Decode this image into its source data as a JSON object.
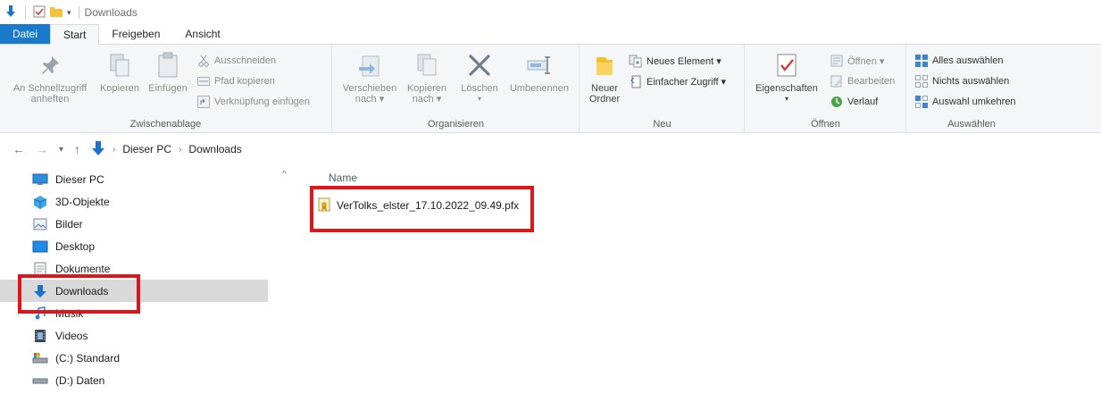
{
  "window": {
    "title": "Downloads"
  },
  "ribbon_tabs": [
    {
      "label": "Datei"
    },
    {
      "label": "Start"
    },
    {
      "label": "Freigeben"
    },
    {
      "label": "Ansicht"
    }
  ],
  "ribbon": {
    "clipboard": {
      "pin_line1": "An Schnellzugriff",
      "pin_line2": "anheften",
      "copy": "Kopieren",
      "paste": "Einfügen",
      "cut": "Ausschneiden",
      "copy_path": "Pfad kopieren",
      "paste_shortcut": "Verknüpfung einfügen",
      "label": "Zwischenablage"
    },
    "organize": {
      "move_line1": "Verschieben",
      "move_line2": "nach ▾",
      "copyto_line1": "Kopieren",
      "copyto_line2": "nach ▾",
      "delete": "Löschen",
      "delete_arrow": "▾",
      "rename": "Umbenennen",
      "label": "Organisieren"
    },
    "new": {
      "folder_line1": "Neuer",
      "folder_line2": "Ordner",
      "new_item": "Neues Element ▾",
      "easy_access": "Einfacher Zugriff ▾",
      "label": "Neu"
    },
    "open": {
      "properties": "Eigenschaften",
      "properties_arrow": "▾",
      "open_btn": "Öffnen ▾",
      "edit": "Bearbeiten",
      "history": "Verlauf",
      "label": "Öffnen"
    },
    "select": {
      "select_all": "Alles auswählen",
      "select_none": "Nichts auswählen",
      "invert": "Auswahl umkehren",
      "label": "Auswählen"
    }
  },
  "address": {
    "crumbs": [
      "Dieser PC",
      "Downloads"
    ]
  },
  "nav": {
    "items": [
      {
        "label": "Dieser PC"
      },
      {
        "label": "3D-Objekte"
      },
      {
        "label": "Bilder"
      },
      {
        "label": "Desktop"
      },
      {
        "label": "Dokumente"
      },
      {
        "label": "Downloads"
      },
      {
        "label": "Musik"
      },
      {
        "label": "Videos"
      },
      {
        "label": "(C:) Standard"
      },
      {
        "label": "(D:) Daten"
      }
    ]
  },
  "content": {
    "column_name": "Name",
    "files": [
      {
        "name": "VerTolks_elster_17.10.2022_09.49.pfx"
      }
    ]
  },
  "colors": {
    "accent": "#1979ca",
    "highlight": "#e0141b",
    "selection": "#d9d9d9"
  }
}
